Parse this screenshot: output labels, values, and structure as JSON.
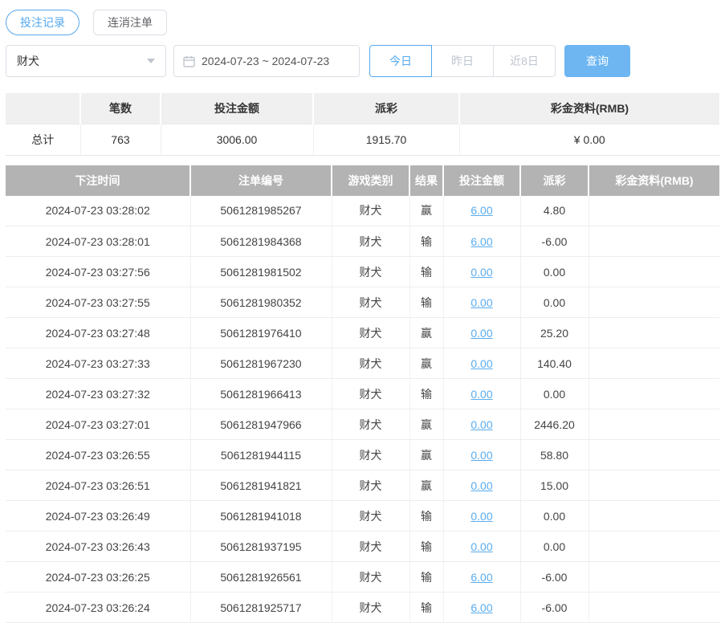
{
  "tabs": [
    {
      "label": "投注记录",
      "active": true
    },
    {
      "label": "连消注单",
      "active": false
    }
  ],
  "filters": {
    "game_select": {
      "value": "财犬"
    },
    "date_range": {
      "value": "2024-07-23 ~ 2024-07-23"
    },
    "quick_buttons": [
      {
        "label": "今日",
        "active": true
      },
      {
        "label": "昨日",
        "active": false
      },
      {
        "label": "近8日",
        "active": false
      }
    ],
    "query_label": "查询"
  },
  "summary": {
    "headers": [
      "",
      "笔数",
      "投注金额",
      "派彩",
      "彩金资料(RMB)"
    ],
    "row": {
      "label": "总计",
      "count": "763",
      "bet_amount": "3006.00",
      "payout": "1915.70",
      "bonus": "¥ 0.00"
    }
  },
  "table": {
    "headers": [
      "下注时间",
      "注单编号",
      "游戏类别",
      "结果",
      "投注金额",
      "派彩",
      "彩金资料(RMB)"
    ],
    "rows": [
      {
        "time": "2024-07-23 03:28:02",
        "order_no": "5061281985267",
        "game": "财犬",
        "result": "赢",
        "bet": "6.00",
        "payout": "4.80",
        "bonus": ""
      },
      {
        "time": "2024-07-23 03:28:01",
        "order_no": "5061281984368",
        "game": "财犬",
        "result": "输",
        "bet": "6.00",
        "payout": "-6.00",
        "bonus": ""
      },
      {
        "time": "2024-07-23 03:27:56",
        "order_no": "5061281981502",
        "game": "财犬",
        "result": "输",
        "bet": "0.00",
        "payout": "0.00",
        "bonus": ""
      },
      {
        "time": "2024-07-23 03:27:55",
        "order_no": "5061281980352",
        "game": "财犬",
        "result": "输",
        "bet": "0.00",
        "payout": "0.00",
        "bonus": ""
      },
      {
        "time": "2024-07-23 03:27:48",
        "order_no": "5061281976410",
        "game": "财犬",
        "result": "赢",
        "bet": "0.00",
        "payout": "25.20",
        "bonus": ""
      },
      {
        "time": "2024-07-23 03:27:33",
        "order_no": "5061281967230",
        "game": "财犬",
        "result": "赢",
        "bet": "0.00",
        "payout": "140.40",
        "bonus": ""
      },
      {
        "time": "2024-07-23 03:27:32",
        "order_no": "5061281966413",
        "game": "财犬",
        "result": "输",
        "bet": "0.00",
        "payout": "0.00",
        "bonus": ""
      },
      {
        "time": "2024-07-23 03:27:01",
        "order_no": "5061281947966",
        "game": "财犬",
        "result": "赢",
        "bet": "0.00",
        "payout": "2446.20",
        "bonus": ""
      },
      {
        "time": "2024-07-23 03:26:55",
        "order_no": "5061281944115",
        "game": "财犬",
        "result": "赢",
        "bet": "0.00",
        "payout": "58.80",
        "bonus": ""
      },
      {
        "time": "2024-07-23 03:26:51",
        "order_no": "5061281941821",
        "game": "财犬",
        "result": "赢",
        "bet": "0.00",
        "payout": "15.00",
        "bonus": ""
      },
      {
        "time": "2024-07-23 03:26:49",
        "order_no": "5061281941018",
        "game": "财犬",
        "result": "输",
        "bet": "0.00",
        "payout": "0.00",
        "bonus": ""
      },
      {
        "time": "2024-07-23 03:26:43",
        "order_no": "5061281937195",
        "game": "财犬",
        "result": "输",
        "bet": "0.00",
        "payout": "0.00",
        "bonus": ""
      },
      {
        "time": "2024-07-23 03:26:25",
        "order_no": "5061281926561",
        "game": "财犬",
        "result": "输",
        "bet": "6.00",
        "payout": "-6.00",
        "bonus": ""
      },
      {
        "time": "2024-07-23 03:26:24",
        "order_no": "5061281925717",
        "game": "财犬",
        "result": "输",
        "bet": "6.00",
        "payout": "-6.00",
        "bonus": ""
      }
    ]
  },
  "colors": {
    "accent_blue": "#54a8ee",
    "query_button_blue": "#6db6f2",
    "negative_red": "#e65c5c",
    "table_header_gray": "#b3b3b3"
  }
}
